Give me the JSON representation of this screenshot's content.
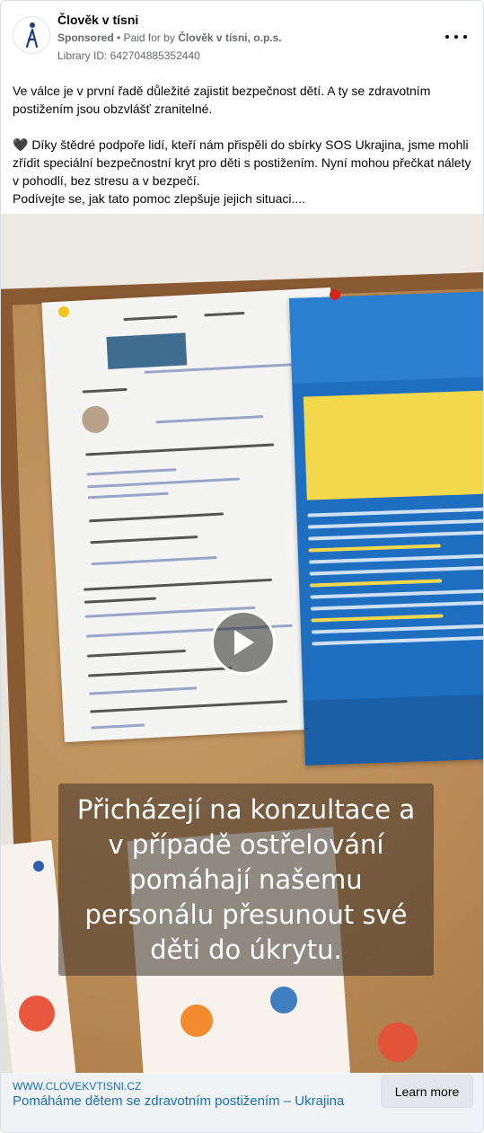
{
  "header": {
    "page_name": "Člověk v tísni",
    "sponsored_label": "Sponsored",
    "paid_for_prefix": " • Paid for by ",
    "paid_for_org": "Člověk v tísni, o.p.s.",
    "library_id": "Library ID: 642704885352440",
    "more_icon": "more-horizontal-icon",
    "logo_icon": "person-logo-icon"
  },
  "post": {
    "paragraph_1": "Ve válce je v první řadě důležité zajistit bezpečnost dětí. A ty se zdravotním postižením jsou obzvlášť zranitelné.",
    "paragraph_2": "🖤 Díky štědré podpoře lidí, kteří nám přispěli do sbírky SOS Ukrajina, jsme mohli zřídit speciální bezpečnostní kryt pro děti s postižením. Nyní mohou přečkat nálety v pohodlí, bez stresu a v bezpečí.",
    "paragraph_3": "Podívejte se, jak tato pomoc zlepšuje jejich situaci...."
  },
  "video": {
    "caption_lines": [
      "Přicházejí na konzultace a",
      "v případě ostřelování",
      "pomáhají našemu",
      "personálu přesunout své",
      "děti do úkrytu."
    ],
    "play_icon": "play-icon"
  },
  "link_footer": {
    "domain": "WWW.CLOVEKVTISNI.CZ",
    "headline": "Pomáháme dětem se zdravotním postižením – Ukrajina",
    "cta_label": "Learn more"
  },
  "colors": {
    "link_blue": "#1870b8",
    "footer_bg": "#f0f2f5",
    "meta_gray": "#65676b"
  }
}
